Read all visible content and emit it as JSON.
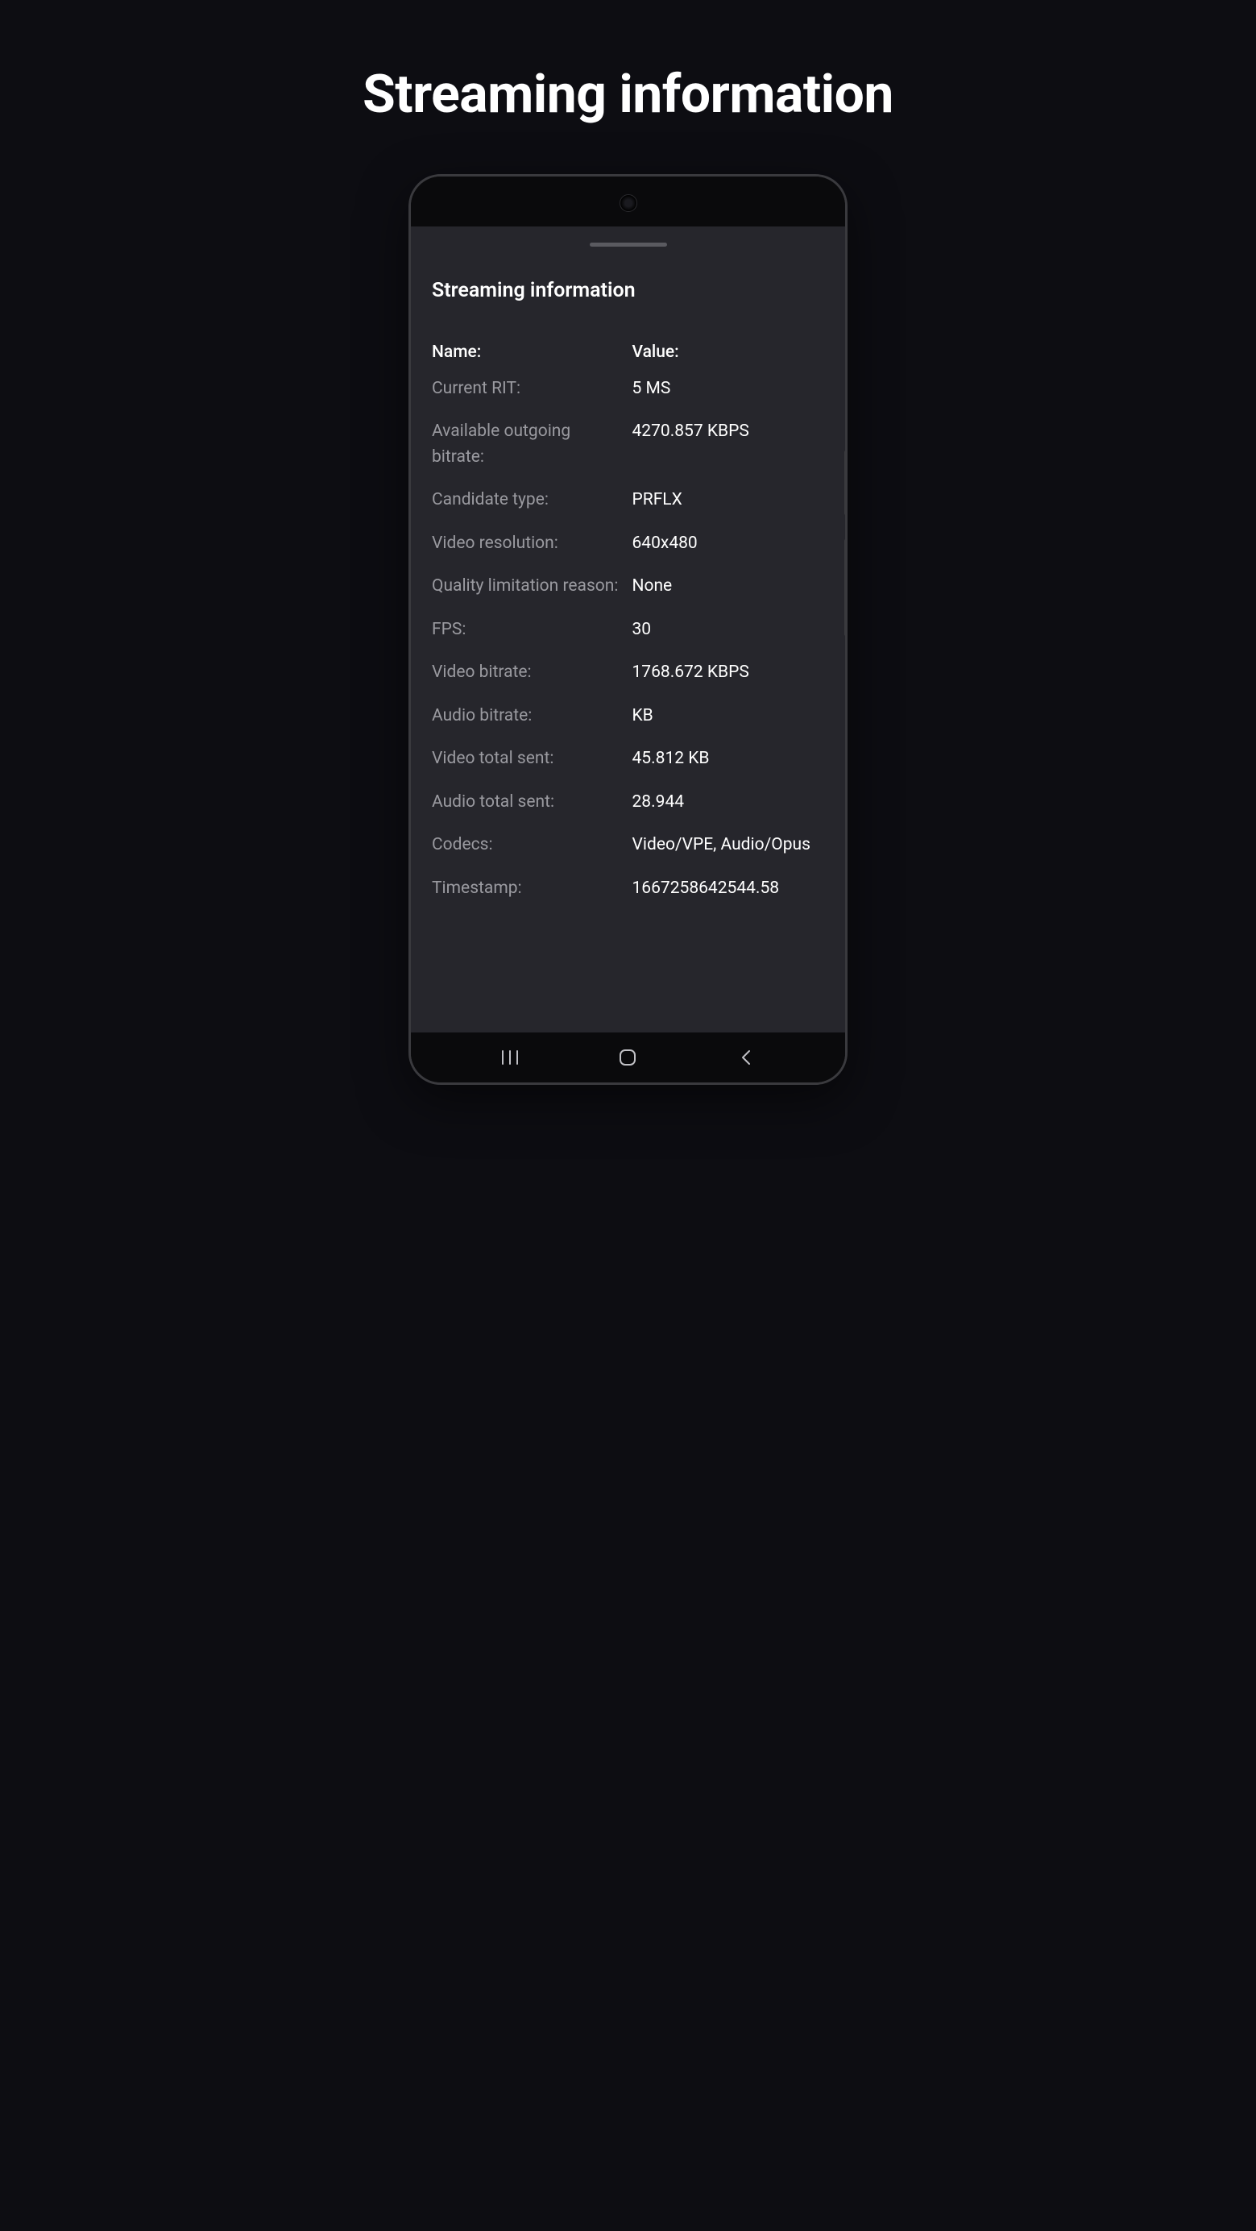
{
  "page": {
    "title": "Streaming information"
  },
  "panel": {
    "title": "Streaming information",
    "headers": {
      "name_col": "Name:",
      "value_col": "Value:"
    },
    "rows": [
      {
        "label": "Current RIT:",
        "value": "5 MS"
      },
      {
        "label": "Available outgoing bitrate:",
        "value": "4270.857 KBPS"
      },
      {
        "label": "Candidate type:",
        "value": "PRFLX"
      },
      {
        "label": "Video resolution:",
        "value": "640x480"
      },
      {
        "label": "Quality limitation reason:",
        "value": "None"
      },
      {
        "label": "FPS:",
        "value": "30"
      },
      {
        "label": "Video bitrate:",
        "value": "1768.672 KBPS"
      },
      {
        "label": "Audio bitrate:",
        "value": "KB"
      },
      {
        "label": "Video total sent:",
        "value": "45.812 KB"
      },
      {
        "label": "Audio total sent:",
        "value": "28.944"
      },
      {
        "label": "Codecs:",
        "value": "Video/VPE, Audio/Opus"
      },
      {
        "label": "Timestamp:",
        "value": "1667258642544.58"
      }
    ]
  }
}
